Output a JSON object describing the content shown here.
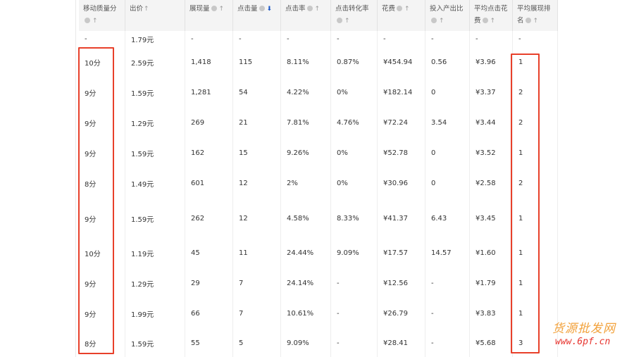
{
  "columns": [
    {
      "label": "移动质量分",
      "info": true
    },
    {
      "label": "出价",
      "info": false
    },
    {
      "label": "展现量",
      "info": true
    },
    {
      "label": "点击量",
      "info": true,
      "sort_active": true
    },
    {
      "label": "点击率",
      "info": true
    },
    {
      "label": "点击转化率",
      "info": true
    },
    {
      "label": "花费",
      "info": true
    },
    {
      "label": "投入产出比",
      "info": true
    },
    {
      "label": "平均点击花费",
      "info": true
    },
    {
      "label": "平均展现排名",
      "info": true
    }
  ],
  "summary_row": [
    "-",
    "1.79元",
    "-",
    "-",
    "-",
    "-",
    "-",
    "-",
    "-",
    "-"
  ],
  "rows": [
    [
      "10分",
      "2.59元",
      "1,418",
      "115",
      "8.11%",
      "0.87%",
      "¥454.94",
      "0.56",
      "¥3.96",
      "1"
    ],
    [
      "9分",
      "1.59元",
      "1,281",
      "54",
      "4.22%",
      "0%",
      "¥182.14",
      "0",
      "¥3.37",
      "2"
    ],
    [
      "9分",
      "1.29元",
      "269",
      "21",
      "7.81%",
      "4.76%",
      "¥72.24",
      "3.54",
      "¥3.44",
      "2"
    ],
    [
      "9分",
      "1.59元",
      "162",
      "15",
      "9.26%",
      "0%",
      "¥52.78",
      "0",
      "¥3.52",
      "1"
    ],
    [
      "8分",
      "1.49元",
      "601",
      "12",
      "2%",
      "0%",
      "¥30.96",
      "0",
      "¥2.58",
      "2"
    ],
    [
      "9分",
      "1.59元",
      "262",
      "12",
      "4.58%",
      "8.33%",
      "¥41.37",
      "6.43",
      "¥3.45",
      "1"
    ],
    [
      "10分",
      "1.19元",
      "45",
      "11",
      "24.44%",
      "9.09%",
      "¥17.57",
      "14.57",
      "¥1.60",
      "1"
    ],
    [
      "9分",
      "1.29元",
      "29",
      "7",
      "24.14%",
      "-",
      "¥12.56",
      "-",
      "¥1.79",
      "1"
    ],
    [
      "9分",
      "1.99元",
      "66",
      "7",
      "10.61%",
      "-",
      "¥26.79",
      "-",
      "¥3.83",
      "1"
    ],
    [
      "8分",
      "1.59元",
      "55",
      "5",
      "9.09%",
      "-",
      "¥28.41",
      "-",
      "¥5.68",
      "3"
    ]
  ],
  "watermark": {
    "text": "货源批发网",
    "url": "www.6pf.cn"
  },
  "colors": {
    "highlight": "#e8402a",
    "sort_active": "#1a56c6",
    "watermark_cn": "#f2a23c",
    "watermark_url": "#e7332d"
  }
}
